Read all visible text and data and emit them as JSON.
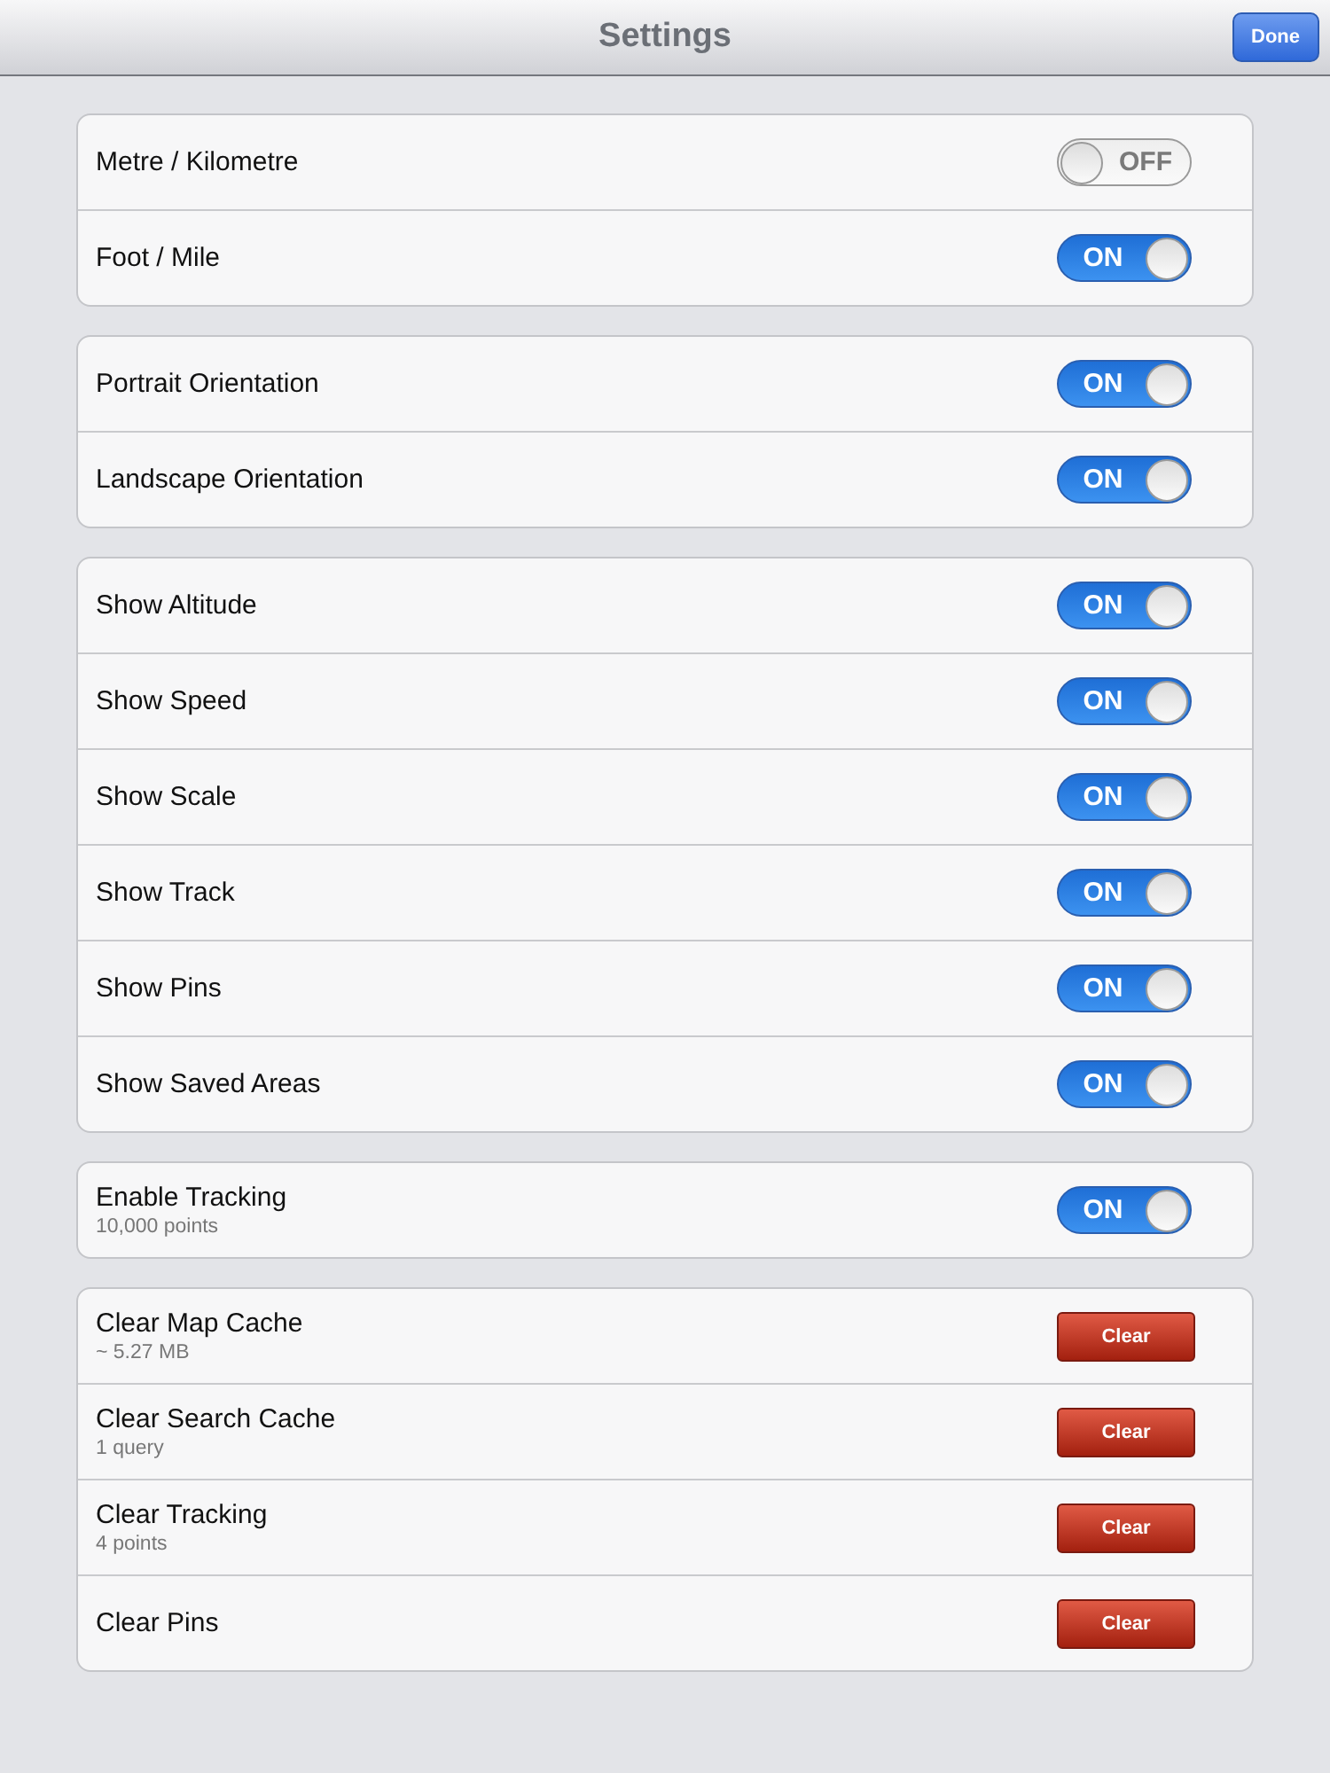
{
  "nav_bar": {
    "title": "Settings",
    "done_button": "Done"
  },
  "groups": [
    {
      "rows": [
        {
          "kind": "toggle",
          "label": "Metre / Kilometre",
          "on": false,
          "switch_text": "OFF"
        },
        {
          "kind": "toggle",
          "label": "Foot / Mile",
          "on": true,
          "switch_text": "ON"
        }
      ]
    },
    {
      "rows": [
        {
          "kind": "toggle",
          "label": "Portrait Orientation",
          "on": true,
          "switch_text": "ON"
        },
        {
          "kind": "toggle",
          "label": "Landscape Orientation",
          "on": true,
          "switch_text": "ON"
        }
      ]
    },
    {
      "rows": [
        {
          "kind": "toggle",
          "label": "Show Altitude",
          "on": true,
          "switch_text": "ON"
        },
        {
          "kind": "toggle",
          "label": "Show Speed",
          "on": true,
          "switch_text": "ON"
        },
        {
          "kind": "toggle",
          "label": "Show Scale",
          "on": true,
          "switch_text": "ON"
        },
        {
          "kind": "toggle",
          "label": "Show Track",
          "on": true,
          "switch_text": "ON"
        },
        {
          "kind": "toggle",
          "label": "Show Pins",
          "on": true,
          "switch_text": "ON"
        },
        {
          "kind": "toggle",
          "label": "Show Saved Areas",
          "on": true,
          "switch_text": "ON"
        }
      ]
    },
    {
      "rows": [
        {
          "kind": "toggle",
          "label": "Enable Tracking",
          "subtitle": "10,000 points",
          "on": true,
          "switch_text": "ON"
        }
      ]
    },
    {
      "rows": [
        {
          "kind": "button",
          "label": "Clear Map Cache",
          "subtitle": "~ 5.27 MB",
          "button": "Clear"
        },
        {
          "kind": "button",
          "label": "Clear Search Cache",
          "subtitle": "1 query",
          "button": "Clear"
        },
        {
          "kind": "button",
          "label": "Clear Tracking",
          "subtitle": "4 points",
          "button": "Clear"
        },
        {
          "kind": "button",
          "label": "Clear Pins",
          "button": "Clear"
        }
      ]
    }
  ]
}
